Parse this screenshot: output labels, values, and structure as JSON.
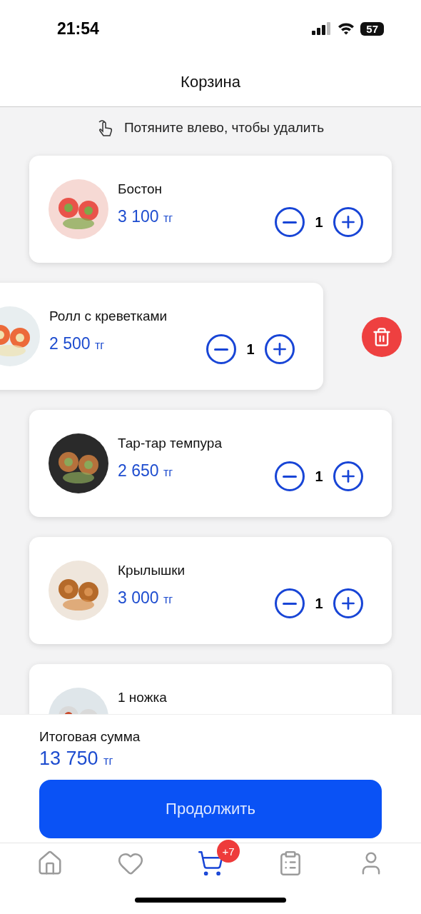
{
  "status_bar": {
    "time": "21:54",
    "battery": "57"
  },
  "header": {
    "title": "Корзина"
  },
  "hint": "Потяните влево, чтобы удалить",
  "items": [
    {
      "name": "Бостон",
      "price": "3 100",
      "currency": "тг",
      "quantity": "1",
      "swiped": false,
      "kind": "picture"
    },
    {
      "name": "Ролл с креветками",
      "price": "2 500",
      "currency": "тг",
      "quantity": "1",
      "swiped": true,
      "kind": "picture"
    },
    {
      "name": "Тар-тар темпура",
      "price": "2 650",
      "currency": "тг",
      "quantity": "1",
      "swiped": false,
      "kind": "picture"
    },
    {
      "name": "Крылышки",
      "price": "3 000",
      "currency": "тг",
      "quantity": "1",
      "swiped": false,
      "kind": "picture"
    },
    {
      "name": "1 ножка",
      "swiped": false,
      "kind": "picture"
    }
  ],
  "total": {
    "label": "Итоговая сумма",
    "amount": "13 750",
    "currency": "тг"
  },
  "continue_button": "Продолжить",
  "tab_bar": [
    {
      "selected": false
    },
    {
      "selected": false
    },
    {
      "selected": true,
      "badge": "+7"
    },
    {
      "selected": false
    },
    {
      "selected": false
    }
  ]
}
